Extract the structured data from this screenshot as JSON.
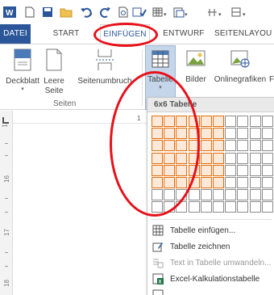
{
  "quick_access": {
    "icons": [
      "word-logo-icon",
      "new-document-icon",
      "save-icon",
      "open-folder-icon",
      "undo-icon",
      "redo-icon",
      "print-preview-icon",
      "spelling-icon",
      "table-icon",
      "paste-icon",
      "align-icon",
      "more-icon"
    ]
  },
  "tabs": {
    "datei": "DATEI",
    "start": "START",
    "einfuegen": "EINFÜGEN",
    "entwurf": "ENTWURF",
    "seitenlayout": "SEITENLAYOU"
  },
  "ribbon": {
    "deckblatt": "Deckblatt",
    "leere_seite_1": "Leere",
    "leere_seite_2": "Seite",
    "seitenumbruch": "Seitenumbruch",
    "tabelle": "Tabelle",
    "bilder": "Bilder",
    "onlinegrafiken": "Onlinegrafiken",
    "more": "F",
    "group_seiten": "Seiten"
  },
  "ruler": {
    "corner": "L",
    "top_mark": "1",
    "marks": [
      "1",
      "16",
      "17",
      "18"
    ]
  },
  "table_dropdown": {
    "title": "6x6 Tabelle",
    "grid_cols": 10,
    "grid_rows": 8,
    "selected_cols": 6,
    "selected_rows": 6,
    "items": [
      {
        "label": "Tabelle einfügen...",
        "enabled": true
      },
      {
        "label": "Tabelle zeichnen",
        "enabled": true
      },
      {
        "label": "Text in Tabelle umwandeln...",
        "enabled": false
      },
      {
        "label": "Excel-Kalkulationstabelle",
        "enabled": true
      }
    ]
  },
  "colors": {
    "accent": "#2b579a",
    "selection_border": "#e46c0a",
    "selection_fill": "#fde9d9",
    "annotation": "#e8101a"
  }
}
